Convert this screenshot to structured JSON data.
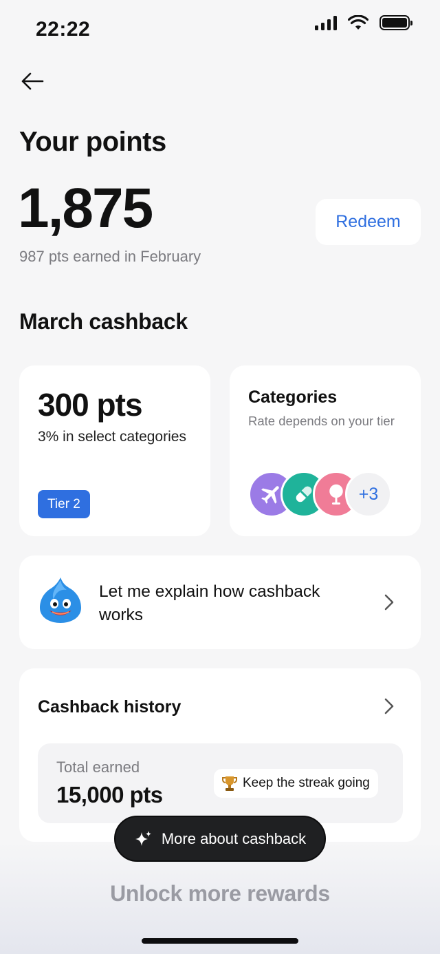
{
  "status_bar": {
    "time": "22:22"
  },
  "header": {
    "title": "Your points"
  },
  "points": {
    "value": "1,875",
    "earned_text": "987 pts earned in February",
    "redeem_label": "Redeem"
  },
  "cashback": {
    "section_title": "March cashback",
    "points_card": {
      "value": "300 pts",
      "description": "3% in select categories",
      "tier": "Tier 2"
    },
    "categories_card": {
      "title": "Categories",
      "subtitle": "Rate depends on your tier",
      "icons": [
        "airplane-icon",
        "pill-icon",
        "mirror-icon"
      ],
      "more": "+3"
    },
    "explain_card": {
      "text": "Let me explain how cashback works"
    },
    "history_card": {
      "title": "Cashback history",
      "total_label": "Total earned",
      "total_value": "15,000 pts",
      "streak_label": "Keep the streak going"
    }
  },
  "floating_button": {
    "label": "More about cashback"
  },
  "footer": {
    "teaser": "Unlock more rewards"
  },
  "colors": {
    "accent": "#2f6fe0",
    "background": "#f6f6f7",
    "travel": "#9b7be6",
    "pharmacy": "#1fb39a",
    "beauty": "#f07c97"
  }
}
